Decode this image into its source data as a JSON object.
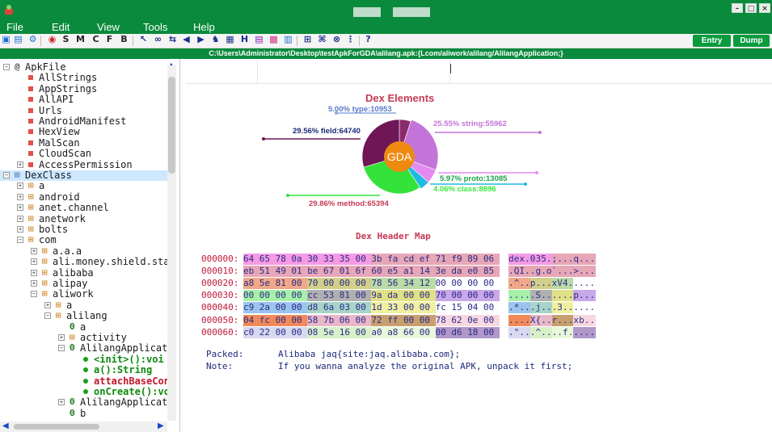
{
  "menu": [
    "File",
    "Edit",
    "View",
    "Tools",
    "Help"
  ],
  "toolbar": {
    "icons": [
      "save-icon",
      "open-icon",
      "settings-icon",
      "locate-icon",
      "s-icon",
      "m-icon",
      "c-icon",
      "f-icon",
      "b-icon",
      "cursor-icon",
      "chain-icon",
      "forward-icon",
      "back-icon",
      "forward-icon",
      "android-icon",
      "decompile-icon",
      "h-icon",
      "bookmark-icon",
      "grid-icon",
      "export-icon",
      "tree-icon",
      "command-icon",
      "link-icon",
      "grid-icon",
      "help-icon"
    ],
    "letters": [
      "S",
      "M",
      "C",
      "F",
      "B",
      "H",
      "?"
    ],
    "entry_label": "Entry",
    "dump_label": "Dump"
  },
  "path": "C:\\Users\\Administrator\\Desktop\\testApkForGDA\\alilang.apk:{Lcom/aliwork/alilang/AlilangApplication;}",
  "tree": [
    {
      "label": "ApkFile",
      "level": 0,
      "kind": "root"
    },
    {
      "label": "AllStrings",
      "level": 1,
      "kind": "leaf"
    },
    {
      "label": "AppStrings",
      "level": 1,
      "kind": "leaf"
    },
    {
      "label": "AllAPI",
      "level": 1,
      "kind": "leaf"
    },
    {
      "label": "Urls",
      "level": 1,
      "kind": "leaf"
    },
    {
      "label": "AndroidManifest",
      "level": 1,
      "kind": "leaf"
    },
    {
      "label": "HexView",
      "level": 1,
      "kind": "leaf"
    },
    {
      "label": "MalScan",
      "level": 1,
      "kind": "leaf"
    },
    {
      "label": "CloudScan",
      "level": 1,
      "kind": "leaf"
    },
    {
      "label": "AccessPermission",
      "level": 1,
      "kind": "leafexp"
    },
    {
      "label": "DexClass",
      "level": 0,
      "kind": "dex"
    },
    {
      "label": "a",
      "level": 1,
      "kind": "pkg"
    },
    {
      "label": "android",
      "level": 1,
      "kind": "pkg"
    },
    {
      "label": "anet.channel",
      "level": 1,
      "kind": "pkg"
    },
    {
      "label": "anetwork",
      "level": 1,
      "kind": "pkg"
    },
    {
      "label": "bolts",
      "level": 1,
      "kind": "pkg"
    },
    {
      "label": "com",
      "level": 1,
      "kind": "pkgopen"
    },
    {
      "label": "a.a.a",
      "level": 2,
      "kind": "pkg"
    },
    {
      "label": "ali.money.shield.sta",
      "level": 2,
      "kind": "pkg"
    },
    {
      "label": "alibaba",
      "level": 2,
      "kind": "pkg"
    },
    {
      "label": "alipay",
      "level": 2,
      "kind": "pkg"
    },
    {
      "label": "aliwork",
      "level": 2,
      "kind": "pkgopen"
    },
    {
      "label": "a",
      "level": 3,
      "kind": "pkg"
    },
    {
      "label": "alilang",
      "level": 3,
      "kind": "pkgopen"
    },
    {
      "label": "a",
      "level": 4,
      "kind": "cls"
    },
    {
      "label": "activity",
      "level": 4,
      "kind": "pkg"
    },
    {
      "label": "AlilangApplicati",
      "level": 4,
      "kind": "clsopen"
    },
    {
      "label": "<init>():voi",
      "level": 5,
      "kind": "meth"
    },
    {
      "label": "a():String",
      "level": 5,
      "kind": "meth"
    },
    {
      "label": "attachBaseCon",
      "level": 5,
      "kind": "meth"
    },
    {
      "label": "onCreate():vo",
      "level": 5,
      "kind": "meth"
    },
    {
      "label": "AlilangApplicati",
      "level": 4,
      "kind": "cls"
    },
    {
      "label": "b",
      "level": 4,
      "kind": "cls"
    }
  ],
  "colors": {
    "green": "#0a8a3c",
    "method_green": "#0b8a0b",
    "method_red": "#c0162a",
    "tree_blue": "#1447c8"
  },
  "dex": {
    "title": "Dex Elements",
    "center": "GDA",
    "chart_data": {
      "type": "pie",
      "slices": [
        {
          "name": "type",
          "label": "5.00% type:10953",
          "value": 10953,
          "percent": 5.0,
          "color": "#8b2a6a"
        },
        {
          "name": "string",
          "label": "25.55% string:55962",
          "value": 55962,
          "percent": 25.55,
          "color": "#c374d8"
        },
        {
          "name": "proto",
          "label": "5.97% proto:13085",
          "value": 13085,
          "percent": 5.97,
          "color": "#e58af0"
        },
        {
          "name": "class",
          "label": "4.06% class:8896",
          "value": 8896,
          "percent": 4.06,
          "color": "#20b9e2"
        },
        {
          "name": "method",
          "label": "29.86% method:65394",
          "value": 65394,
          "percent": 29.86,
          "color": "#33e33a"
        },
        {
          "name": "field",
          "label": "29.56% field:64740",
          "value": 64740,
          "percent": 29.56,
          "color": "#6e1656"
        }
      ]
    }
  },
  "header_map": {
    "title": "Dex Header Map",
    "rows": [
      {
        "addr": "000000:",
        "hex": "64 65 78 0a 30 33 35 00 3b fa cd ef 71 f9 89 06",
        "ascii": "dex.035.;...q..."
      },
      {
        "addr": "000010:",
        "hex": "eb 51 49 01 be 67 01 6f 60 e5 a1 14 3e da e0 85",
        "ascii": ".QI..g.o`...>..."
      },
      {
        "addr": "000020:",
        "hex": "a8 5e 81 00 70 00 00 00 78 56 34 12 00 00 00 00",
        "ascii": ".^..p...xV4....."
      },
      {
        "addr": "000030:",
        "hex": "00 00 00 00 cc 53 81 00 9a da 00 00 70 00 00 00",
        "ascii": ".....S......p..."
      },
      {
        "addr": "000040:",
        "hex": "c9 2a 00 00 d8 6a 03 00 1d 33 00 00 fc 15 04 00",
        "ascii": ".*...j...3......"
      },
      {
        "addr": "000050:",
        "hex": "04 fc 00 00 58 7b 06 00 72 ff 00 00 78 62 0e 00",
        "ascii": "....X{..r...xb.."
      },
      {
        "addr": "000060:",
        "hex": "c0 22 00 00 08 5e 16 00 a0 a8 66 00 00 d6 18 00",
        "ascii": ".\"...^....f....."
      }
    ]
  },
  "info": {
    "packed_label": "Packed:",
    "packed_value": "Alibaba jaq{site:jaq.alibaba.com};",
    "note_label": "Note:",
    "note_value": "If you wanna analyze the original APK, unpack it first;"
  }
}
